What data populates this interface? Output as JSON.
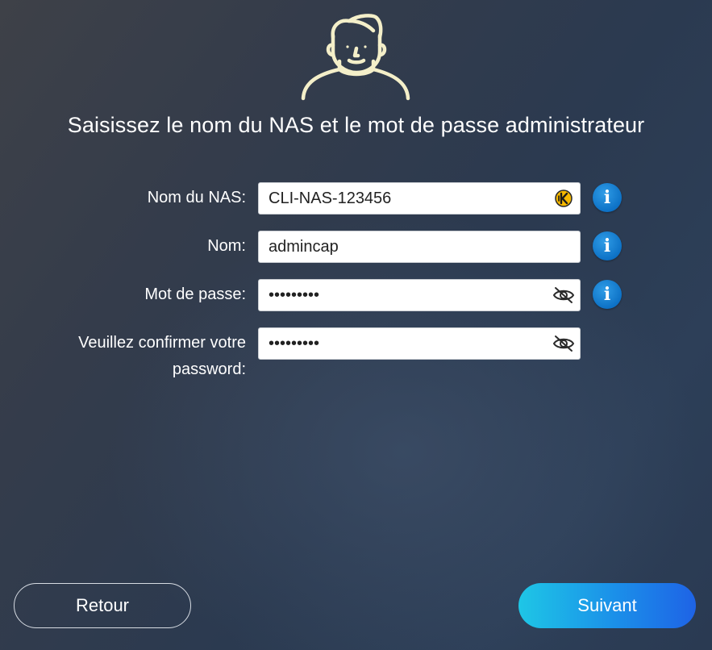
{
  "title": "Saisissez le nom du NAS et le mot de passe administrateur",
  "avatar_icon": "user-avatar-icon",
  "colors": {
    "accent_start": "#1ec6e6",
    "accent_end": "#1e63e6",
    "info_blue": "#0b6fc4",
    "avatar_stroke": "#f4efc9"
  },
  "form": {
    "nas_name": {
      "label": "Nom du NAS:",
      "value": "CLI-NAS-123456",
      "trailing_icon": "keeper-autofill-icon"
    },
    "name": {
      "label": "Nom:",
      "value": "admincap"
    },
    "password": {
      "label": "Mot de passe:",
      "value": "•••••••••",
      "trailing_icon": "eye-slash-icon"
    },
    "confirm_password": {
      "label_line1": "Veuillez confirmer votre",
      "label_line2": "password:",
      "value": "•••••••••",
      "trailing_icon": "eye-slash-icon"
    },
    "info_glyph": "i"
  },
  "buttons": {
    "back": "Retour",
    "next": "Suivant"
  }
}
